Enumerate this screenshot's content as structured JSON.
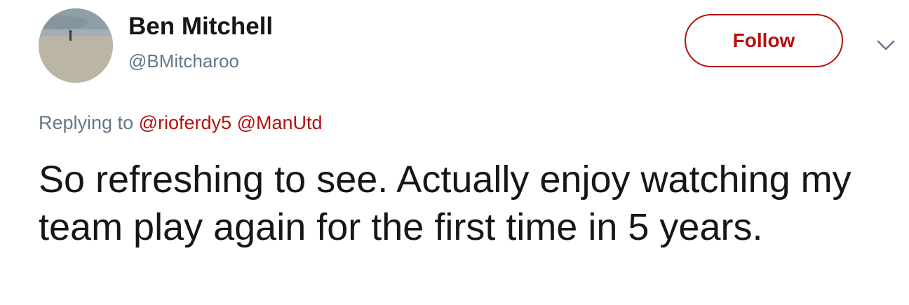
{
  "author": {
    "display_name": "Ben Mitchell",
    "handle": "@BMitcharoo"
  },
  "follow_button": {
    "label": "Follow"
  },
  "more_menu": {
    "icon": "chevron-down-icon"
  },
  "reply": {
    "prefix": "Replying to",
    "mentions": [
      "@rioferdy5",
      "@ManUtd"
    ]
  },
  "tweet": {
    "text": "So refreshing to see. Actually enjoy watching my team play again for the first time in 5 years."
  },
  "colors": {
    "accent": "#b60f0f",
    "secondary_text": "#657786",
    "primary_text": "#14171a"
  }
}
